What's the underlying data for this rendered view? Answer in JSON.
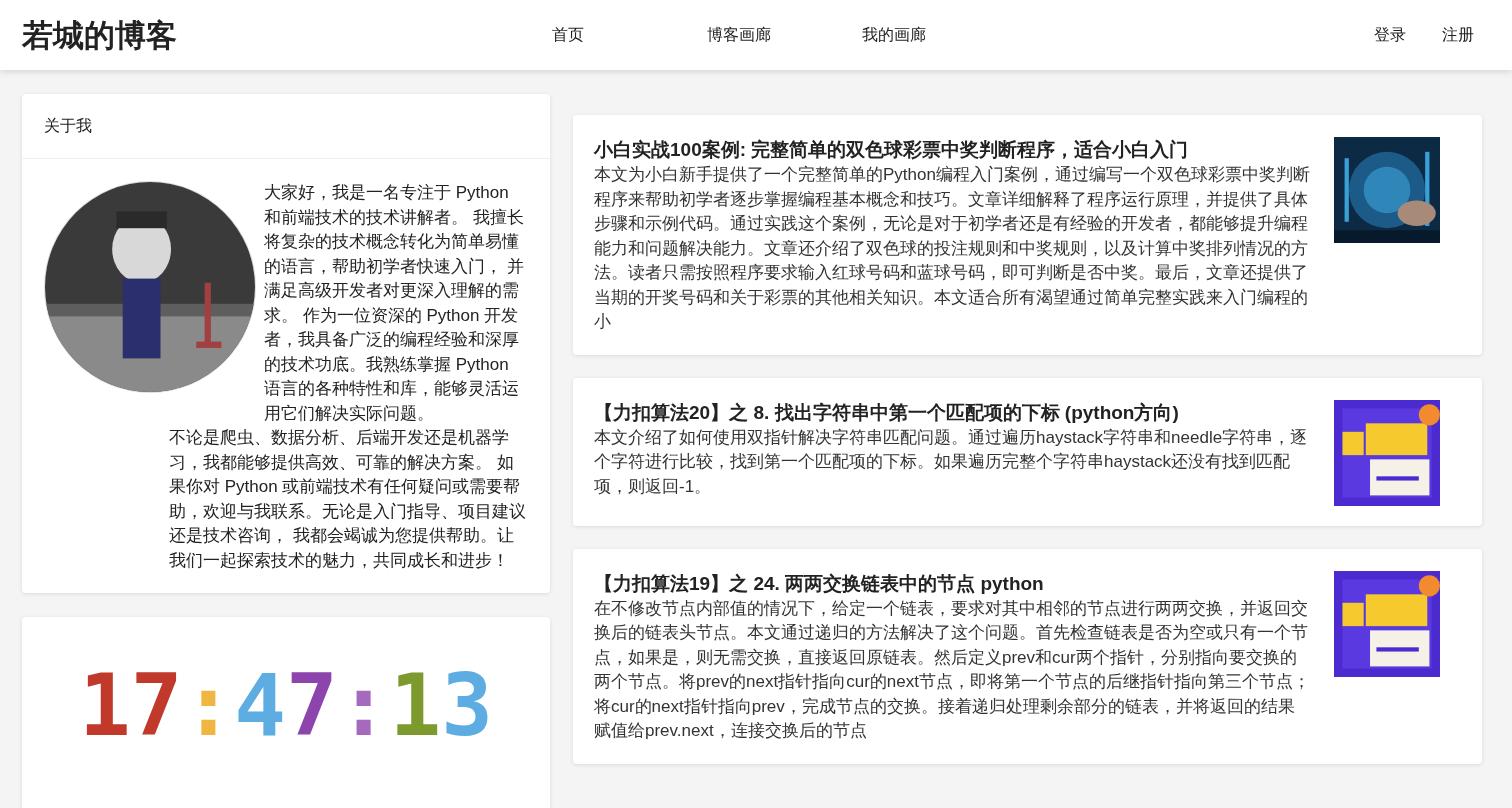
{
  "header": {
    "logo": "若城的博客",
    "nav": [
      {
        "label": "首页"
      },
      {
        "label": "博客画廊"
      },
      {
        "label": "我的画廊"
      }
    ],
    "auth": [
      {
        "label": "登录"
      },
      {
        "label": "注册"
      }
    ]
  },
  "about": {
    "title": "关于我",
    "text_beside": "大家好，我是一名专注于 Python 和前端技术的技术讲解者。 我擅长将复杂的技术概念转化为简单易懂的语言，帮助初学者快速入门， 并满足高级开发者对更深入理解的需求。 作为一位资深的 Python 开发者，我具备广泛的编程经验和深厚的技术功底。我熟练掌握 Python 语言的各种特性和库，能够灵活运用它们解决实际问题。",
    "text_below": "不论是爬虫、数据分析、后端开发还是机器学习，我都能够提供高效、可靠的解决方案。 如果你对 Python 或前端技术有任何疑问或需要帮助，欢迎与我联系。无论是入门指导、项目建议还是技术咨询， 我都会竭诚为您提供帮助。让我们一起探索技术的魅力，共同成长和进步！"
  },
  "clock": {
    "chars": [
      {
        "text": "1",
        "color": "#c0392b"
      },
      {
        "text": "7",
        "color": "#c0392b"
      },
      {
        "text": ":",
        "color": "#f0b642"
      },
      {
        "text": "4",
        "color": "#5dade2"
      },
      {
        "text": "7",
        "color": "#8e44ad"
      },
      {
        "text": ":",
        "color": "#a569bd"
      },
      {
        "text": "1",
        "color": "#7d9a2f"
      },
      {
        "text": "3",
        "color": "#5dade2"
      }
    ]
  },
  "articles": [
    {
      "title": "小白实战100案例: 完整简单的双色球彩票中奖判断程序，适合小白入门",
      "summary": "本文为小白新手提供了一个完整简单的Python编程入门案例，通过编写一个双色球彩票中奖判断程序来帮助初学者逐步掌握编程基本概念和技巧。文章详细解释了程序运行原理，并提供了具体步骤和示例代码。通过实践这个案例，无论是对于初学者还是有经验的开发者，都能够提升编程能力和问题解决能力。文章还介绍了双色球的投注规则和中奖规则，以及计算中奖排列情况的方法。读者只需按照程序要求输入红球号码和蓝球号码，即可判断是否中奖。最后，文章还提供了当期的开奖号码和关于彩票的其他相关知识。本文适合所有渴望通过简单完整实践来入门编程的小"
    },
    {
      "title": "【力扣算法20】之 8. 找出字符串中第一个匹配项的下标 (python方向)",
      "summary": "本文介绍了如何使用双指针解决字符串匹配问题。通过遍历haystack字符串和needle字符串，逐个字符进行比较，找到第一个匹配项的下标。如果遍历完整个字符串haystack还没有找到匹配项，则返回-1。"
    },
    {
      "title": "【力扣算法19】之 24. 两两交换链表中的节点 python",
      "summary": "在不修改节点内部值的情况下，给定一个链表，要求对其中相邻的节点进行两两交换，并返回交换后的链表头节点。本文通过递归的方法解决了这个问题。首先检查链表是否为空或只有一个节点，如果是，则无需交换，直接返回原链表。然后定义prev和cur两个指针，分别指向要交换的两个节点。将prev的next指针指向cur的next节点，即将第一个节点的后继指针指向第三个节点；将cur的next指针指向prev，完成节点的交换。接着递归处理剩余部分的链表，并将返回的结果赋值给prev.next，连接交换后的节点"
    }
  ]
}
